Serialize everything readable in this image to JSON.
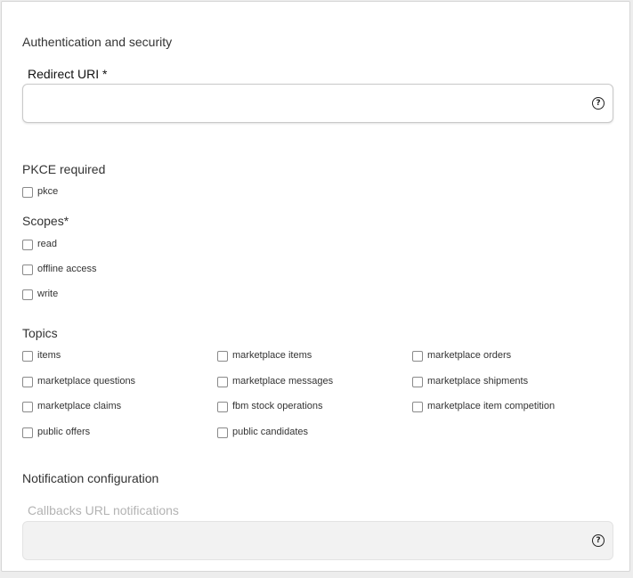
{
  "auth": {
    "title": "Authentication and security",
    "redirect_label": "Redirect URI *",
    "redirect_value": "",
    "help_icon": "question-circle-icon",
    "help_glyph": "?"
  },
  "pkce": {
    "title": "PKCE required",
    "option": "pkce"
  },
  "scopes": {
    "title": "Scopes*",
    "options": [
      "read",
      "offline access",
      "write"
    ]
  },
  "topics": {
    "title": "Topics",
    "columns": [
      [
        "items",
        "marketplace questions",
        "marketplace claims",
        "public offers"
      ],
      [
        "marketplace items",
        "marketplace messages",
        "fbm stock operations",
        "public candidates"
      ],
      [
        "marketplace orders",
        "marketplace shipments",
        "marketplace item competition"
      ]
    ]
  },
  "notifications": {
    "title": "Notification configuration",
    "callbacks_label": "Callbacks URL notifications",
    "callbacks_value": ""
  },
  "colors": {
    "background": "#ededed",
    "card": "#ffffff",
    "text": "#333333",
    "disabled_text": "#b3b3b3",
    "disabled_field": "#f2f2f2"
  }
}
